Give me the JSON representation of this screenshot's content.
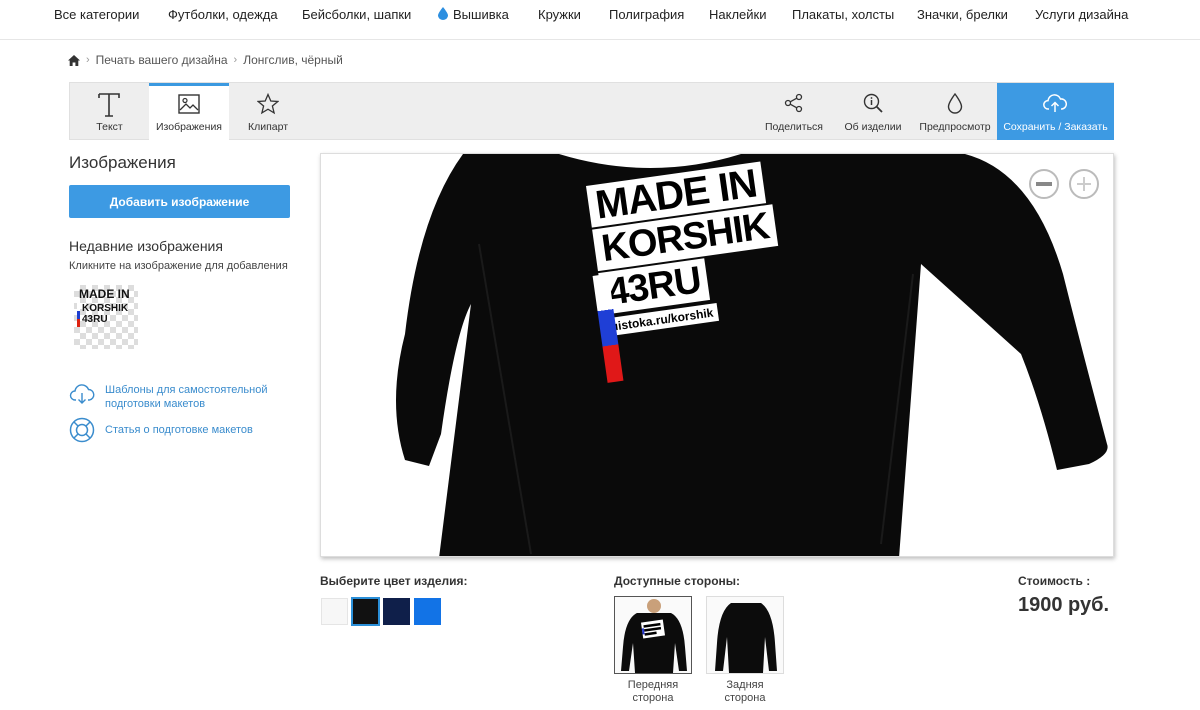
{
  "nav": {
    "items": [
      "Все категории",
      "Футболки, одежда",
      "Бейсболки, шапки",
      "Вышивка",
      "Кружки",
      "Полиграфия",
      "Наклейки",
      "Плакаты, холсты",
      "Значки, брелки",
      "Услуги дизайна"
    ]
  },
  "breadcrumb": {
    "home_icon": "home-icon",
    "items": [
      "Печать вашего дизайна",
      "Лонгслив, чёрный"
    ]
  },
  "toolbar": {
    "text": "Текст",
    "images": "Изображения",
    "clipart": "Клипарт",
    "share": "Поделиться",
    "about": "Об изделии",
    "preview": "Предпросмотр",
    "save": "Сохранить / Заказать"
  },
  "panel": {
    "title": "Изображения",
    "add_button": "Добавить изображение",
    "recent_title": "Недавние изображения",
    "recent_hint": "Кликните на изображение для добавления",
    "thumb_line1": "MADE IN",
    "thumb_line2": "KORSHIK",
    "thumb_line3": "43RU",
    "link_templates_1": "Шаблоны для самостоятельной",
    "link_templates_2": "подготовки макетов",
    "link_article": "Статья о подготовке макетов"
  },
  "design": {
    "line1": "MADE IN",
    "line2": "KORSHIK",
    "line3": "43RU",
    "url": "uistoka.ru/korshik"
  },
  "bottom": {
    "color_label": "Выберите цвет изделия:",
    "colors": [
      "#f7f7f7",
      "#111111",
      "#0f1f4a",
      "#1273e6"
    ],
    "selected_color_index": 1,
    "sides_label": "Доступные стороны:",
    "front_1": "Передняя",
    "front_2": "сторона",
    "back_1": "Задняя",
    "back_2": "сторона",
    "price_label": "Стоимость :",
    "price": "1900 руб."
  },
  "accent_color": "#3d9ae3"
}
